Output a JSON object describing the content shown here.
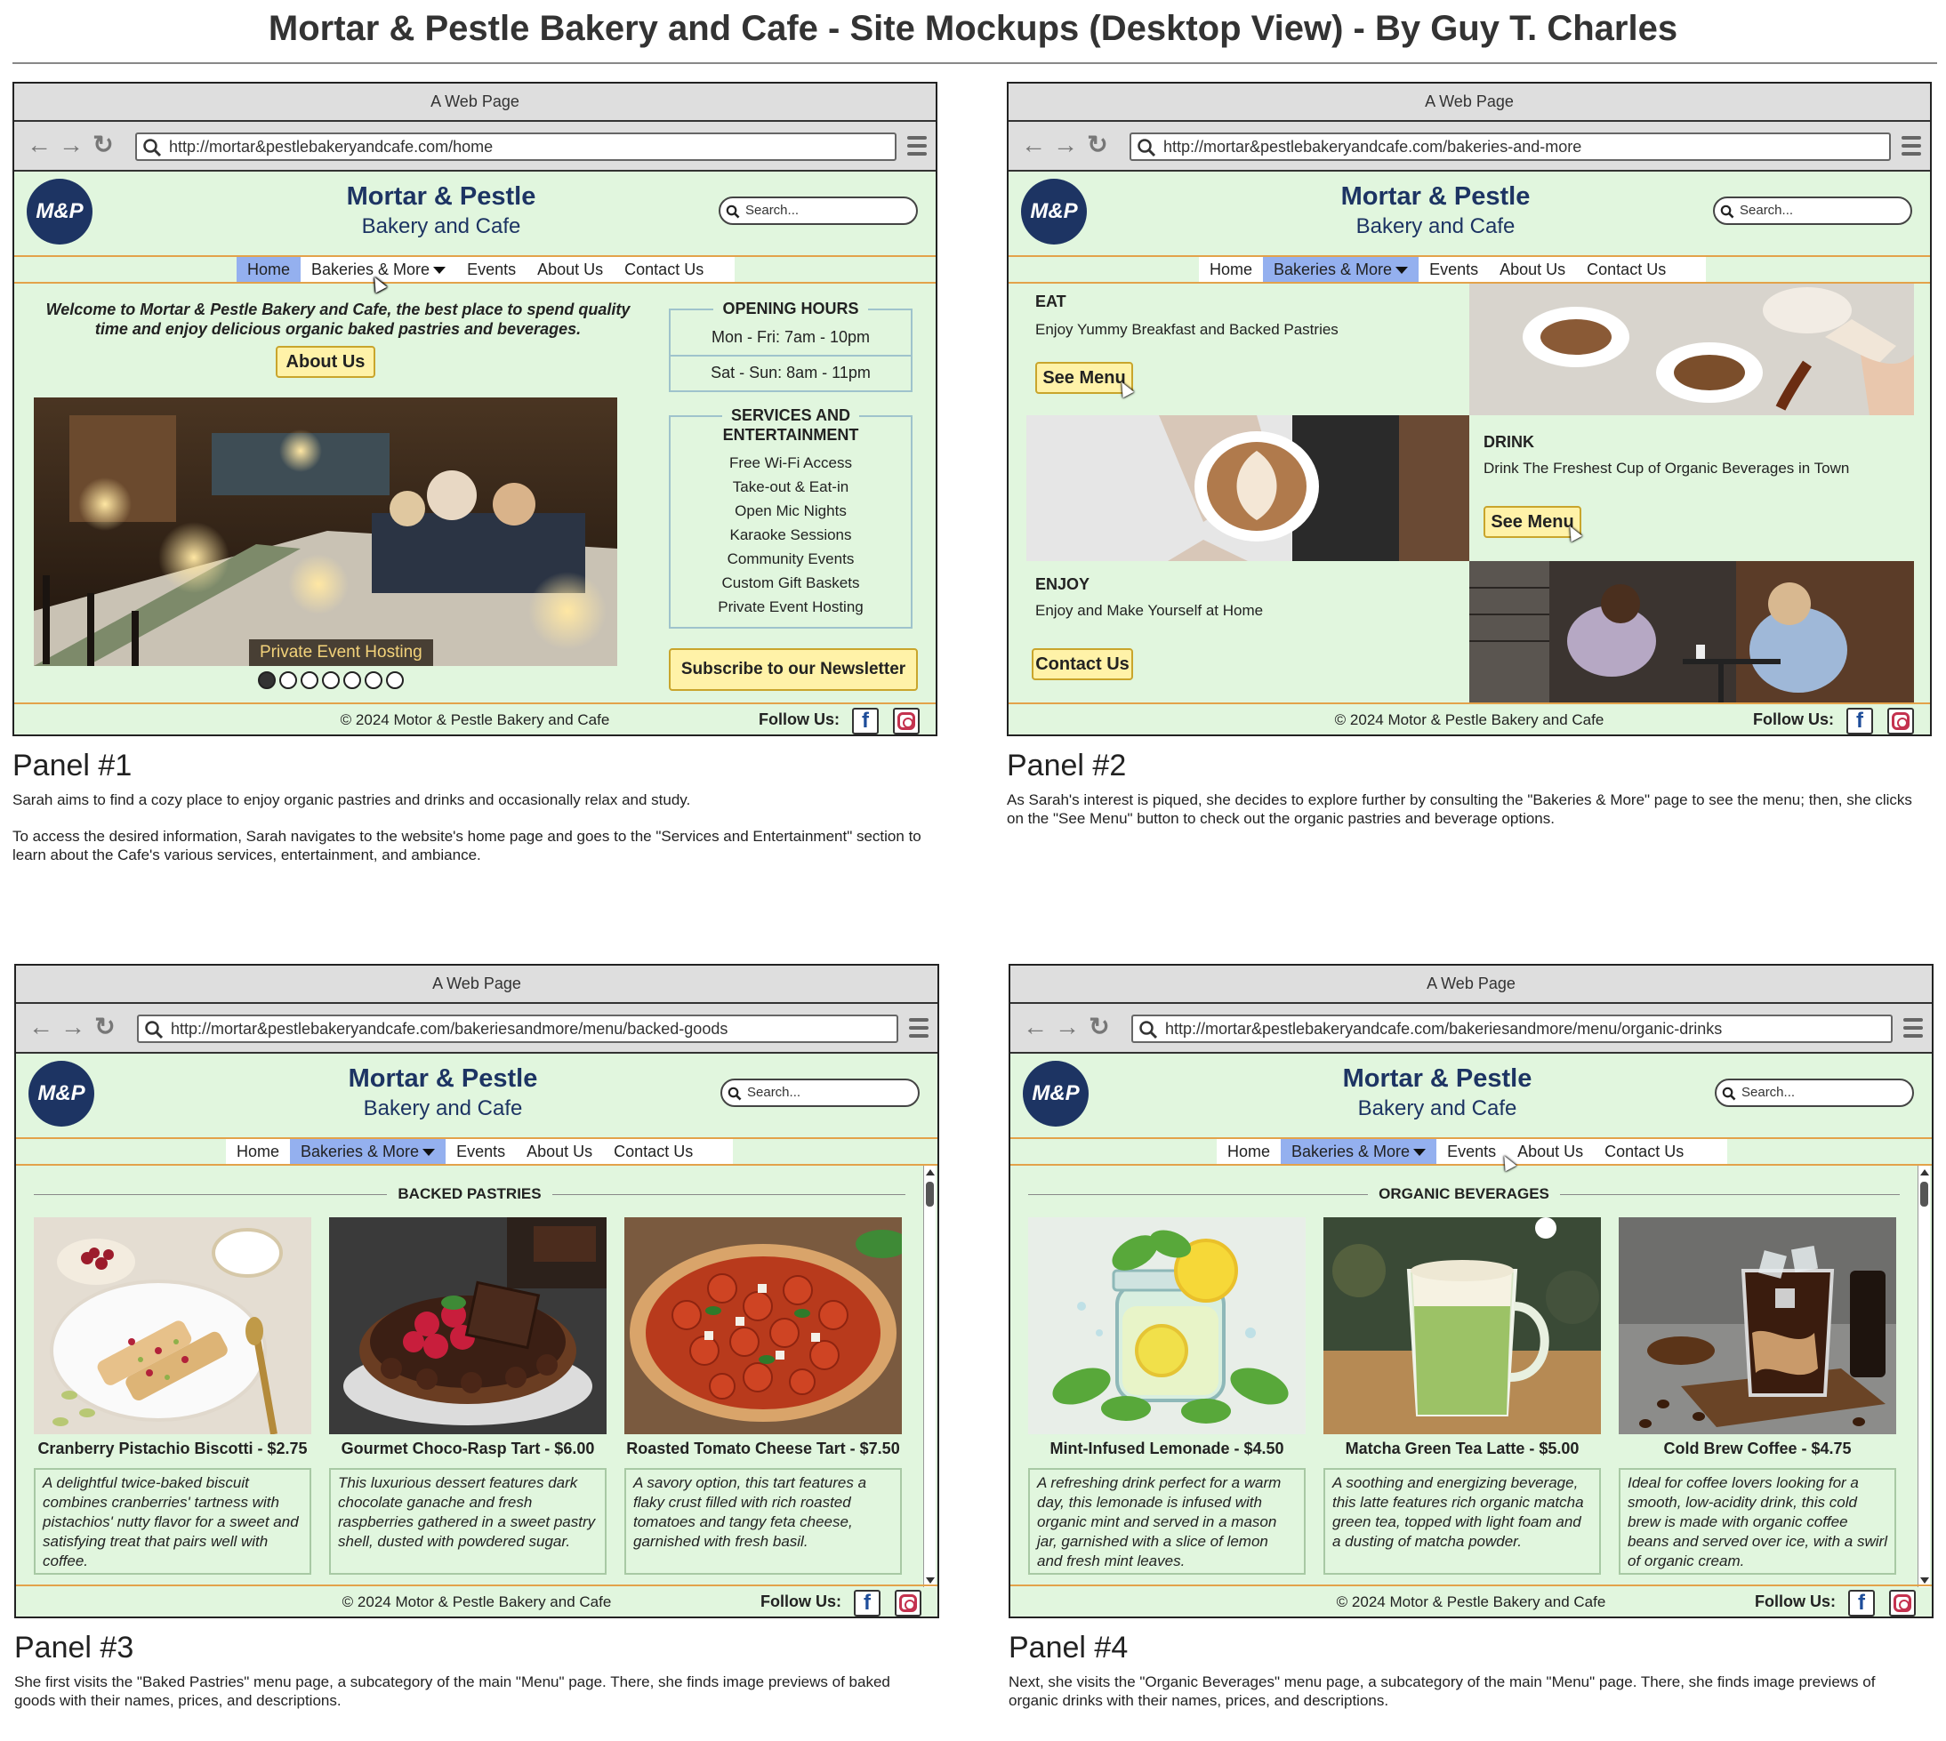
{
  "title": "Mortar & Pestle Bakery and Cafe - Site Mockups (Desktop View) - By Guy T. Charles",
  "browser": {
    "window_title": "A Web Page"
  },
  "site": {
    "logo": "M&P",
    "name": "Mortar & Pestle",
    "tagline": "Bakery and Cafe",
    "search_placeholder": "Search...",
    "copyright": "© 2024 Motor & Pestle Bakery and Cafe",
    "follow": "Follow Us:",
    "fb": "f",
    "menu": [
      "Home",
      "Bakeries & More",
      "Events",
      "About Us",
      "Contact Us"
    ]
  },
  "colors": {
    "bg": "#e1f6de",
    "brand": "#1d3463",
    "active": "#94b0ef",
    "button": "#fff2a8",
    "rule": "#e3a24a"
  },
  "panels": [
    {
      "label": "Panel #1",
      "url": "http://mortar&pestlebakeryandcafe.com/home",
      "active": 0,
      "desc": [
        "Sarah aims to find a cozy place to enjoy organic pastries and drinks and occasionally relax and study.",
        "To access the desired information, Sarah navigates to the website's home page and goes to the \"Services and Entertainment\" section to learn about the Cafe's various services, entertainment, and ambiance."
      ],
      "welcome": "Welcome to Mortar & Pestle Bakery and Cafe, the best place to spend quality time and enjoy delicious organic baked pastries and beverages.",
      "about_btn": "About Us",
      "hero_caption": "Private Event Hosting",
      "hours_title": "OPENING HOURS",
      "hours": [
        "Mon - Fri:  7am - 10pm",
        "Sat - Sun:  8am - 11pm"
      ],
      "services_title": [
        "SERVICES AND",
        "ENTERTAINMENT"
      ],
      "services": [
        "Free Wi-Fi Access",
        "Take-out & Eat-in",
        "Open Mic Nights",
        "Karaoke Sessions",
        "Community Events",
        "Custom Gift Baskets",
        "Private Event Hosting"
      ],
      "newsletter": "Subscribe to our Newsletter",
      "slides": {
        "count": 7,
        "current": 1
      }
    },
    {
      "label": "Panel #2",
      "url": "http://mortar&pestlebakeryandcafe.com/bakeries-and-more",
      "active": 1,
      "desc": "As Sarah's interest is piqued, she decides to explore further by consulting the \"Bakeries & More\" page to see the menu; then, she clicks on the \"See Menu\" button to check out the organic pastries and beverage options.",
      "eat_h": "EAT",
      "eat_t": "Enjoy Yummy Breakfast and Backed Pastries",
      "eat_btn": "See Menu",
      "drink_h": "DRINK",
      "drink_t": "Drink The Freshest Cup of Organic Beverages in Town",
      "drink_btn": "See Menu",
      "enjoy_h": "ENJOY",
      "enjoy_t": "Enjoy and Make Yourself at Home",
      "enjoy_btn": "Contact Us"
    },
    {
      "label": "Panel #3",
      "url": "http://mortar&pestlebakeryandcafe.com/bakeriesandmore/menu/backed-goods",
      "active": 1,
      "desc": "She first visits the \"Baked Pastries\" menu page, a subcategory of the main \"Menu\" page. There, she finds image previews of baked goods with their names, prices, and descriptions.",
      "section": "BACKED PASTRIES",
      "items": [
        {
          "name": "Cranberry Pistachio Biscotti - $2.75",
          "desc": "A delightful twice-baked biscuit combines cranberries' tartness with pistachios' nutty flavor for a sweet and satisfying treat that pairs well with coffee."
        },
        {
          "name": "Gourmet Choco-Rasp Tart - $6.00",
          "desc": "This luxurious dessert features dark chocolate ganache and fresh raspberries gathered in a sweet pastry shell, dusted with powdered sugar."
        },
        {
          "name": "Roasted Tomato Cheese Tart - $7.50",
          "desc": "A savory option, this tart features a flaky crust filled with rich roasted tomatoes and tangy feta cheese, garnished with fresh basil."
        }
      ]
    },
    {
      "label": "Panel #4",
      "url": "http://mortar&pestlebakeryandcafe.com/bakeriesandmore/menu/organic-drinks",
      "active": 1,
      "desc": "Next, she visits the \"Organic Beverages\" menu page, a subcategory of the main \"Menu\" page. There, she finds image previews of organic drinks with their names, prices, and descriptions.",
      "section": "ORGANIC BEVERAGES",
      "items": [
        {
          "name": "Mint-Infused Lemonade - $4.50",
          "desc": "A refreshing drink perfect for a warm day, this lemonade is infused with organic mint and served in a mason jar, garnished with a slice of lemon and fresh mint leaves."
        },
        {
          "name": "Matcha Green Tea Latte - $5.00",
          "desc": "A soothing and energizing beverage, this latte features rich organic matcha green tea, topped with light foam and a dusting of matcha powder."
        },
        {
          "name": "Cold Brew Coffee - $4.75",
          "desc": "Ideal for coffee lovers looking for a smooth, low-acidity drink, this cold brew is made with organic coffee beans and served over ice, with a swirl of organic cream."
        }
      ]
    }
  ]
}
